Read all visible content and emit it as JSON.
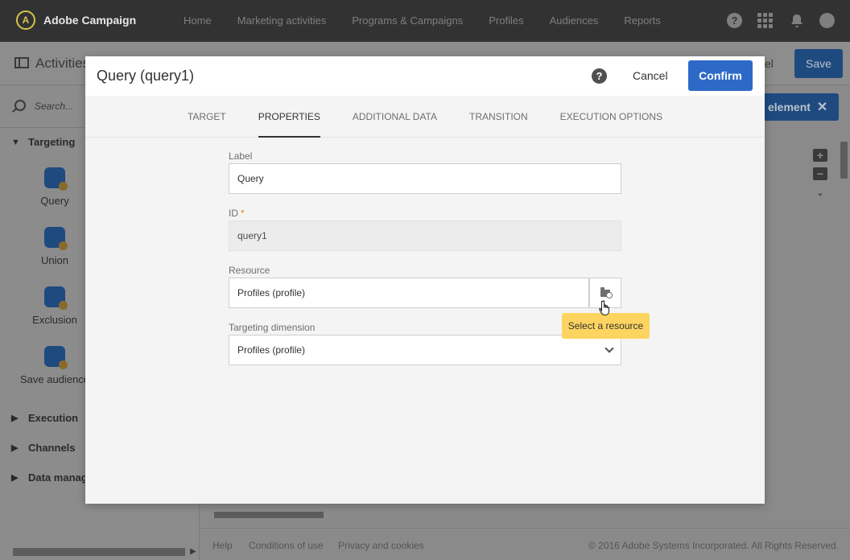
{
  "app": {
    "brand": "Adobe Campaign",
    "nav": [
      "Home",
      "Marketing activities",
      "Programs & Campaigns",
      "Profiles",
      "Audiences",
      "Reports"
    ]
  },
  "background": {
    "breadcrumb_title": "Activities",
    "cancel_partial": "el",
    "save_label": "Save",
    "search_placeholder": "Search...",
    "add_element_partial": "element",
    "groups": {
      "targeting": "Targeting",
      "execution": "Execution",
      "channels": "Channels",
      "data_management": "Data manage"
    },
    "activities": [
      "Query",
      "Union",
      "Exclusion",
      "Save audience"
    ],
    "footer": {
      "help": "Help",
      "conditions": "Conditions of use",
      "privacy": "Privacy and cookies",
      "copyright": "© 2016 Adobe Systems Incorporated. All Rights Reserved."
    }
  },
  "modal": {
    "title": "Query (query1)",
    "cancel_label": "Cancel",
    "confirm_label": "Confirm",
    "tabs": [
      {
        "label": "TARGET",
        "active": false
      },
      {
        "label": "PROPERTIES",
        "active": true
      },
      {
        "label": "ADDITIONAL DATA",
        "active": false
      },
      {
        "label": "TRANSITION",
        "active": false
      },
      {
        "label": "EXECUTION OPTIONS",
        "active": false
      }
    ],
    "fields": {
      "label": {
        "label": "Label",
        "value": "Query"
      },
      "id": {
        "label": "ID",
        "required_mark": "*",
        "value": "query1"
      },
      "resource": {
        "label": "Resource",
        "value": "Profiles (profile)"
      },
      "targeting_dimension": {
        "label": "Targeting dimension",
        "value": "Profiles (profile)"
      }
    },
    "tooltip": "Select a resource"
  },
  "colors": {
    "accent": "#2d6ac7",
    "topbar": "#323232",
    "tooltip": "#fdd460",
    "required": "#e68619"
  }
}
